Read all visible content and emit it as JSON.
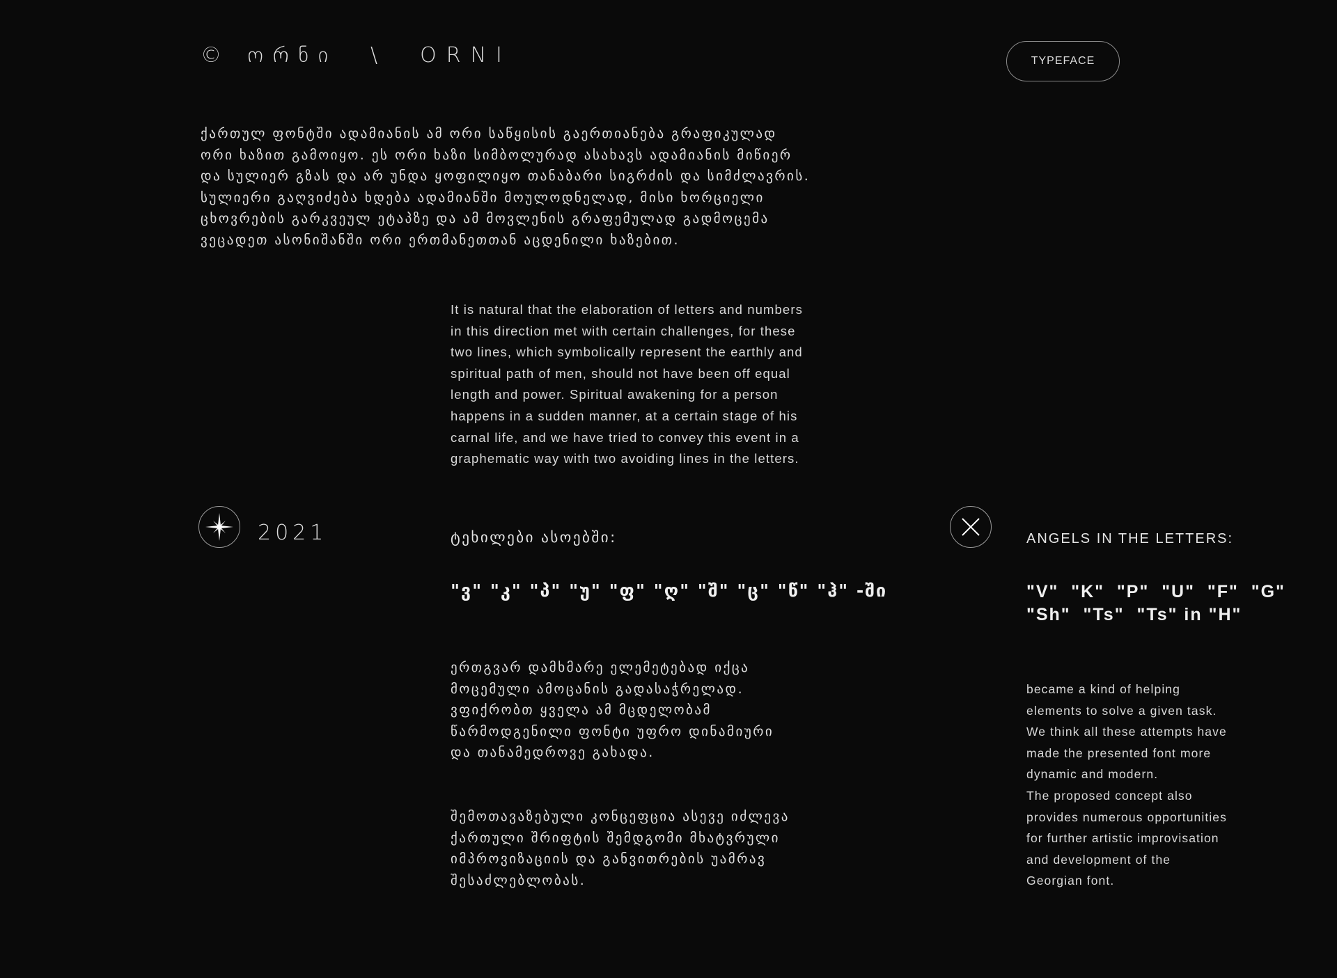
{
  "header": {
    "logo": "© ორნი  \\  ORNI",
    "typeface_button": "TYPEFACE"
  },
  "intro_georgian": [
    "ქართულ ფონტში ადამიანის ამ ორი საწყისის გაერთიანება გრაფიკულად",
    "ორი ხაზით გამოიყო. ეს ორი ხაზი სიმბოლურად ასახავს ადამიანის მიწიერ",
    "და სულიერ გზას და არ უნდა ყოფილიყო თანაბარი სიგრძის და სიმძლავრის.",
    "სულიერი გაღვიძება ხდება ადამიანში მოულოდნელად, მისი ხორციელი",
    "ცხოვრების გარკვეულ ეტაპზე და ამ მოვლენის გრაფემულად გადმოცემა",
    "ვეცადეთ  ასონიშანში ორი ერთმანეთთან აცდენილი ხაზებით."
  ],
  "intro_english": [
    "It is natural that the elaboration of letters and numbers",
    "in this direction met with certain challenges, for these",
    "two lines, which symbolically represent the earthly and",
    "spiritual path of men, should not have been off equal",
    "length and power. Spiritual awakening for a person",
    "happens in a sudden manner, at a certain stage of his",
    "carnal life, and we have tried to convey this event in a",
    "graphematic way with two avoiding lines in the letters."
  ],
  "year": "2021",
  "georgian_section": {
    "heading": "ტეხილები ასოებში:",
    "letters": "\"ვ\" \"კ\" \"პ\" \"უ\" \"ფ\" \"ღ\" \"შ\" \"ც\" \"წ\" \"ჰ\" -ში",
    "paragraph1": [
      "ერთგვარ დამხმარე ელემეტებად იქცა",
      "მოცემული ამოცანის გადასაჭრელად.",
      "ვფიქრობთ ყველა ამ მცდელობამ",
      "წარმოდგენილი ფონტი უფრო დინამიური",
      "და თანამედროვე გახადა."
    ],
    "paragraph2": [
      "შემოთავაზებული კონცეფცია ასევე იძლევა",
      "ქართული შრიფტის შემდგომი მხატვრული",
      "იმპროვიზაციის და განვითრების უამრავ",
      "შესაძლებლობას."
    ]
  },
  "english_section": {
    "heading": "ANGELS IN THE LETTERS:",
    "letters_line1": "\"V\"  \"K\"  \"P\"  \"U\"  \"F\"  \"G\"",
    "letters_line2": "\"Sh\"  \"Ts\"  \"Ts\" in \"H\"",
    "paragraph": [
      "became a kind of helping",
      "elements to solve a given task.",
      "We think all these attempts have",
      "made the presented font more",
      "dynamic and modern.",
      "The proposed concept also",
      "provides numerous opportunities",
      "for further artistic improvisation",
      "and development of the",
      "Georgian font."
    ]
  },
  "icons": {
    "star": "sparkle-star-icon",
    "cross": "x-cross-icon"
  },
  "colors": {
    "background": "#0a0a0a",
    "text": "#e4e4e4",
    "border": "#8a8a8a"
  }
}
